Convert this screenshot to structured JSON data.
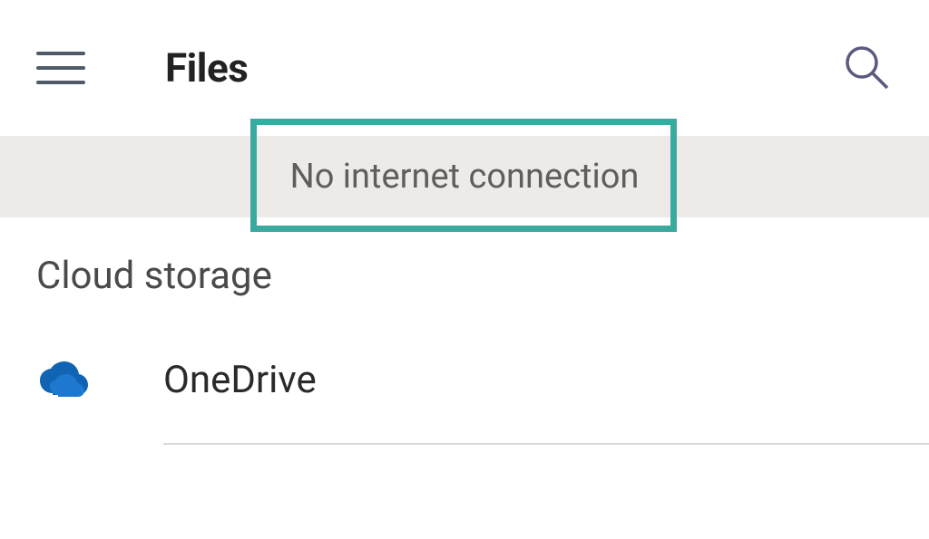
{
  "header": {
    "title": "Files"
  },
  "banner": {
    "message": "No internet connection"
  },
  "section": {
    "title": "Cloud storage",
    "items": [
      {
        "label": "OneDrive",
        "icon": "onedrive-icon"
      }
    ]
  },
  "colors": {
    "highlight": "#3aa99f",
    "onedrive": "#1064b3"
  }
}
